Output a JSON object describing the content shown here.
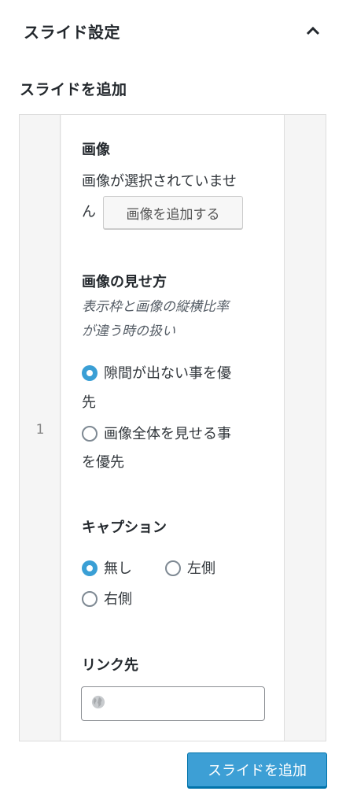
{
  "panel": {
    "title": "スライド設定",
    "toggle_icon": "chevron-up-icon"
  },
  "section": {
    "label": "スライドを追加"
  },
  "slide": {
    "number": "1",
    "image": {
      "title": "画像",
      "status_line1": "画像が選択されていませ",
      "status_line2": "ん",
      "button": "画像を追加する"
    },
    "fit": {
      "title": "画像の見せ方",
      "desc_line1": "表示枠と画像の縦横比率",
      "desc_line2": "が違う時の扱い",
      "options": [
        {
          "line1": "隙間が出ない事を優",
          "line2": "先",
          "checked": true
        },
        {
          "line1": "画像全体を見せる事",
          "line2": "を優先",
          "checked": false
        }
      ]
    },
    "caption": {
      "title": "キャプション",
      "options": [
        {
          "label": "無し",
          "checked": true
        },
        {
          "label": "左側",
          "checked": false
        },
        {
          "label": "右側",
          "checked": false
        }
      ]
    },
    "link": {
      "title": "リンク先",
      "value": "",
      "placeholder": "",
      "icon": "globe-icon"
    }
  },
  "add_button": {
    "label": "スライドを追加"
  },
  "colors": {
    "accent": "#3d9fd5",
    "accent_border": "#0073aa"
  }
}
